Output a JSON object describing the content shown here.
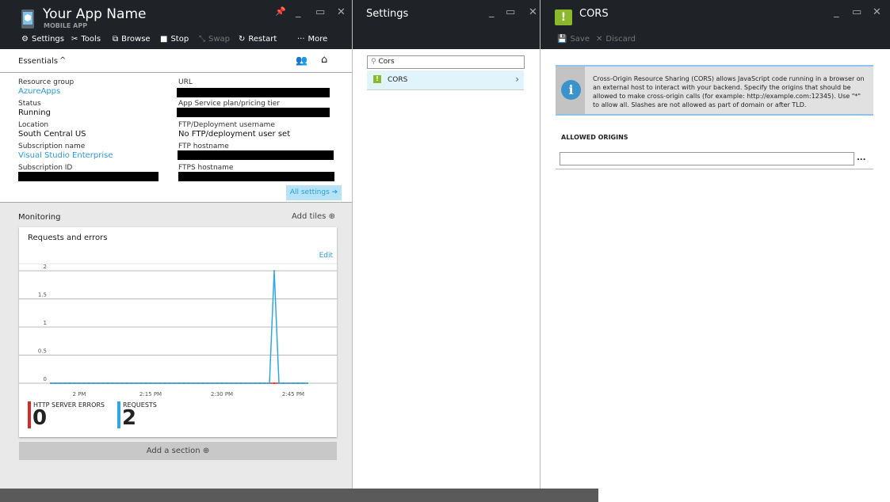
{
  "app": {
    "title": "Your App Name",
    "subtitle": "MOBILE APP",
    "commands": [
      {
        "label": "Settings",
        "icon": "gear-icon"
      },
      {
        "label": "Tools",
        "icon": "tools-icon"
      },
      {
        "label": "Browse",
        "icon": "browse-icon"
      },
      {
        "label": "Stop",
        "icon": "stop-icon"
      },
      {
        "label": "Swap",
        "icon": "swap-icon",
        "disabled": true
      },
      {
        "label": "Restart",
        "icon": "restart-icon"
      },
      {
        "label": "More",
        "icon": "more-icon"
      }
    ],
    "essentials_label": "Essentials",
    "fields": {
      "resource_group_label": "Resource group",
      "resource_group": "AzureApps",
      "status_label": "Status",
      "status": "Running",
      "location_label": "Location",
      "location": "South Central US",
      "subscription_name_label": "Subscription name",
      "subscription_name": "Visual Studio Enterprise",
      "subscription_id_label": "Subscription ID",
      "url_label": "URL",
      "plan_label": "App Service plan/pricing tier",
      "ftp_user_label": "FTP/Deployment username",
      "ftp_user": "No FTP/deployment user set",
      "ftp_host_label": "FTP hostname",
      "ftps_host_label": "FTPS hostname"
    },
    "all_settings": "All settings ➔",
    "monitoring_label": "Monitoring",
    "add_tiles": "Add tiles",
    "add_section": "Add a section"
  },
  "chart_data": {
    "type": "line",
    "title": "Requests and errors",
    "edit": "Edit",
    "yticks": [
      "2",
      "1.5",
      "1",
      "0.5",
      "0"
    ],
    "ylim": [
      0,
      2
    ],
    "xticks": [
      "2 PM",
      "2:15 PM",
      "2:30 PM",
      "2:45 PM"
    ],
    "x_start": "1:54 PM",
    "x_step_minutes": 1,
    "series": [
      {
        "name": "REQUESTS",
        "color": "#2ea8e5",
        "total": "2",
        "values": [
          0,
          0,
          0,
          0,
          0,
          0,
          0,
          0,
          0,
          0,
          0,
          0,
          0,
          0,
          0,
          0,
          0,
          0,
          0,
          0,
          0,
          0,
          0,
          0,
          0,
          0,
          0,
          0,
          0,
          0,
          0,
          0,
          0,
          0,
          0,
          0,
          0,
          0,
          0,
          0,
          0,
          0,
          0,
          0,
          0,
          0,
          0,
          2,
          0,
          0,
          0,
          0,
          0,
          0,
          0
        ]
      },
      {
        "name": "HTTP SERVER ERRORS",
        "color": "#d42a2a",
        "total": "0",
        "values": [
          0,
          0,
          0,
          0,
          0,
          0,
          0,
          0,
          0,
          0,
          0,
          0,
          0,
          0,
          0,
          0,
          0,
          0,
          0,
          0,
          0,
          0,
          0,
          0,
          0,
          0,
          0,
          0,
          0,
          0,
          0,
          0,
          0,
          0,
          0,
          0,
          0,
          0,
          0,
          0,
          0,
          0,
          0,
          0,
          0,
          0,
          0,
          0,
          0,
          0,
          0,
          0,
          0,
          0,
          0
        ]
      }
    ]
  },
  "settings": {
    "title": "Settings",
    "search_value": "Cors",
    "item": "CORS"
  },
  "cors": {
    "title": "CORS",
    "save": "Save",
    "discard": "Discard",
    "info": "Cross-Origin Resource Sharing (CORS) allows JavaScript code running in a browser on an external host to interact with your backend. Specify the origins that should be allowed to make cross-origin calls (for example: http://example.com:12345). Use \"*\" to allow all. Slashes are not allowed as part of domain or after TLD.",
    "allowed_origins_label": "ALLOWED ORIGINS",
    "origin_value": "",
    "more": "..."
  },
  "colors": {
    "header": "#1f2226",
    "accent": "#2b9be0",
    "cors_icon": "#8cb82b"
  }
}
